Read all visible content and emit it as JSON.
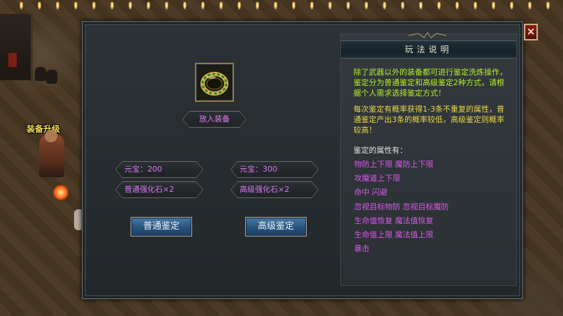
{
  "world": {
    "npc_name": "装备升级",
    "torch_count": 30
  },
  "dialog": {
    "close_label": "×",
    "item_slot": {
      "icon": "jade-ring-icon"
    },
    "put_item_label": "放入装备",
    "normal": {
      "cost_yuanbao": "元宝：200",
      "cost_stone": "普通强化石×2",
      "button_label": "普通鉴定"
    },
    "advanced": {
      "cost_yuanbao": "元宝：300",
      "cost_stone": "高级强化石×2",
      "button_label": "高级鉴定"
    },
    "info": {
      "title": "玩法说明",
      "desc_1": "除了武器以外的装备都可进行鉴定洗炼操作，鉴定分为普通鉴定和高级鉴定2种方式，请根据个人需求选择鉴定方式！",
      "desc_2": "每次鉴定有概率获得1-3条不重复的属性，普通鉴定产出3条的概率较低，高级鉴定则概率较高！",
      "attributes_title": "鉴定的属性有：",
      "attributes": [
        "物防上下限  魔防上下限",
        "攻魔道上下限",
        "命中  闪避",
        "忽视目标物防  忽视目标魔防",
        "生命值恢复  魔法值恢复",
        "生命值上限  魔法值上限",
        "暴击"
      ]
    }
  },
  "colors": {
    "green_text": "#b5ee2a",
    "yellow_text": "#e8d44a",
    "magenta_text": "#d65ae8",
    "button_blue": "#27527c"
  }
}
